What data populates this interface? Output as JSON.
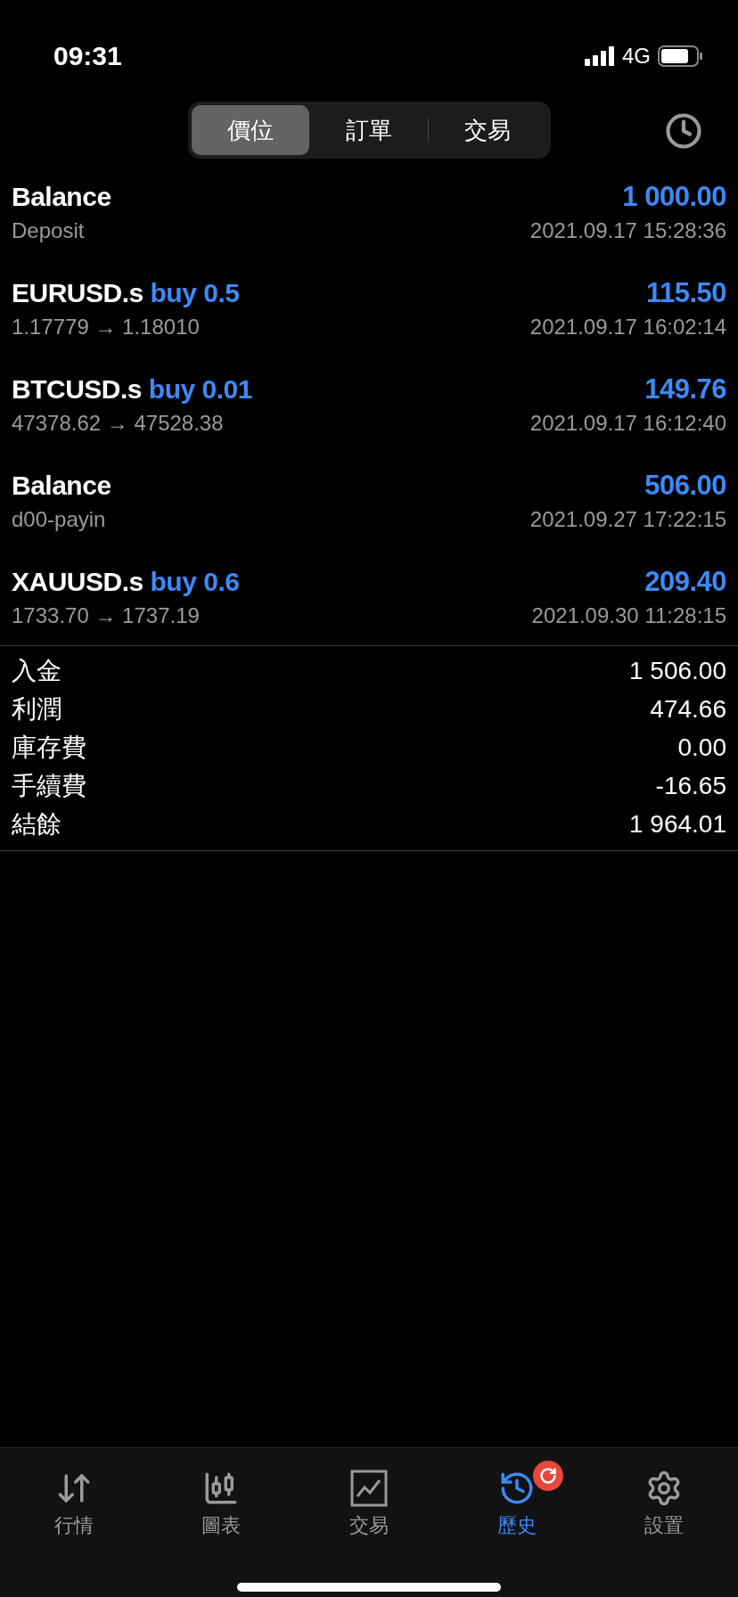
{
  "status_bar": {
    "time": "09:31",
    "network": "4G"
  },
  "segments": [
    {
      "label": "價位",
      "selected": true
    },
    {
      "label": "訂單",
      "selected": false
    },
    {
      "label": "交易",
      "selected": false
    }
  ],
  "deals": [
    {
      "kind": "balance",
      "symbol": "Balance",
      "amount": "1 000.00",
      "detail": "Deposit",
      "time": "2021.09.17 15:28:36"
    },
    {
      "kind": "trade",
      "symbol": "EURUSD.s",
      "trade": "buy 0.5",
      "amount": "115.50",
      "detail": "1.17779 → 1.18010",
      "time": "2021.09.17 16:02:14"
    },
    {
      "kind": "trade",
      "symbol": "BTCUSD.s",
      "trade": "buy 0.01",
      "amount": "149.76",
      "detail": "47378.62 → 47528.38",
      "time": "2021.09.17 16:12:40"
    },
    {
      "kind": "balance",
      "symbol": "Balance",
      "amount": "506.00",
      "detail": "d00-payin",
      "time": "2021.09.27 17:22:15"
    },
    {
      "kind": "trade",
      "symbol": "XAUUSD.s",
      "trade": "buy 0.6",
      "amount": "209.40",
      "detail": "1733.70 → 1737.19",
      "time": "2021.09.30 11:28:15"
    }
  ],
  "summary": [
    {
      "label": "入金",
      "value": "1 506.00"
    },
    {
      "label": "利潤",
      "value": "474.66"
    },
    {
      "label": "庫存費",
      "value": "0.00"
    },
    {
      "label": "手續費",
      "value": "-16.65"
    },
    {
      "label": "結餘",
      "value": "1 964.01"
    }
  ],
  "tab_bar": [
    {
      "kind": "quotes",
      "label": "行情",
      "selected": false
    },
    {
      "kind": "chart",
      "label": "圖表",
      "selected": false
    },
    {
      "kind": "trade",
      "label": "交易",
      "selected": false
    },
    {
      "kind": "history",
      "label": "歷史",
      "selected": true,
      "badge": true
    },
    {
      "kind": "settings",
      "label": "設置",
      "selected": false
    }
  ]
}
